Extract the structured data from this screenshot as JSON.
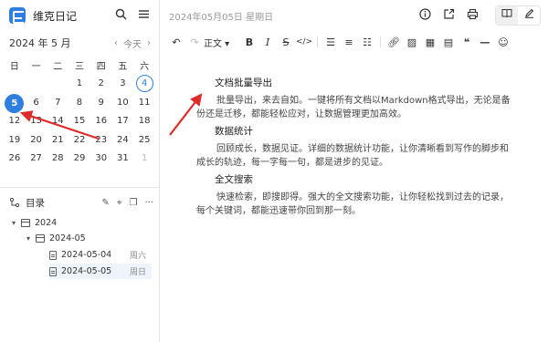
{
  "app": {
    "title": "维克日记"
  },
  "calendar": {
    "month_label": "2024 年 5 月",
    "prev_glyph": "‹",
    "today_label": "今天",
    "next_glyph": "›",
    "weekdays": [
      "日",
      "一",
      "二",
      "三",
      "四",
      "五",
      "六"
    ],
    "weeks": [
      [
        "",
        "",
        "",
        "1",
        "2",
        "3",
        "4"
      ],
      [
        "5",
        "6",
        "7",
        "8",
        "9",
        "10",
        "11"
      ],
      [
        "12",
        "13",
        "14",
        "15",
        "16",
        "17",
        "18"
      ],
      [
        "19",
        "20",
        "21",
        "22",
        "23",
        "24",
        "25"
      ],
      [
        "26",
        "27",
        "28",
        "29",
        "30",
        "31",
        "1"
      ]
    ],
    "selected_day": "5",
    "today_day": "4"
  },
  "toc": {
    "label": "目录",
    "tree": {
      "year": "2024",
      "month": "2024-05",
      "entries": [
        {
          "date": "2024-05-04",
          "weekday": "周六"
        },
        {
          "date": "2024-05-05",
          "weekday": "周日"
        }
      ]
    }
  },
  "editor": {
    "date_line": "2024年05月05日 星期日",
    "style_select": "正文",
    "sections": [
      {
        "heading": "文档批量导出",
        "body": "批量导出，来去自如。一键将所有文档以Markdown格式导出，无论是备份还是迁移，都能轻松应对，让数据管理更加高效。"
      },
      {
        "heading": "数据统计",
        "body": "回顾成长，数据见证。详细的数据统计功能，让你清晰看到写作的脚步和成长的轨迹，每一字每一句，都是进步的见证。"
      },
      {
        "heading": "全文搜索",
        "body": "快速检索，即搜即得。强大的全文搜索功能，让你轻松找到过去的记录，每个关键词，都能迅速带你回到那一刻。"
      }
    ]
  },
  "colors": {
    "accent": "#2f7fe0",
    "annotation": "#e02b2b"
  }
}
